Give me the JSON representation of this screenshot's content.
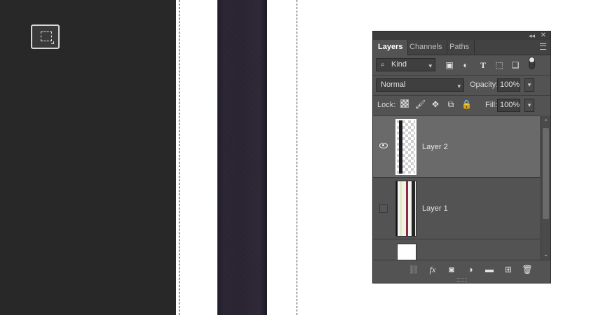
{
  "panel": {
    "collapse_glyph": "◂◂",
    "close_glyph": "✕",
    "tabs": [
      {
        "label": "Layers",
        "active": true
      },
      {
        "label": "Channels",
        "active": false
      },
      {
        "label": "Paths",
        "active": false
      }
    ],
    "filter": {
      "label": "Kind"
    },
    "blend_mode": "Normal",
    "opacity_label": "Opacity:",
    "opacity_value": "100%",
    "lock_label": "Lock:",
    "fill_label": "Fill:",
    "fill_value": "100%",
    "layers": [
      {
        "name": "Layer 2",
        "visible": true,
        "selected": true
      },
      {
        "name": "Layer 1",
        "visible": false,
        "selected": false
      },
      {
        "name": "",
        "visible": false,
        "selected": false
      }
    ]
  },
  "icons": {
    "filter": [
      "image-icon",
      "adjustment-icon",
      "type-icon",
      "shape-icon",
      "smart-object-icon"
    ],
    "lock": [
      "lock-transparent-icon",
      "lock-image-icon",
      "lock-position-icon",
      "lock-artboard-icon",
      "lock-all-icon"
    ],
    "bottom": [
      "link-icon",
      "fx-icon",
      "mask-icon",
      "adjustment-layer-icon",
      "folder-icon",
      "new-layer-icon",
      "trash-icon"
    ]
  },
  "colors": {
    "toolbar_bg": "#282828",
    "panel_bg": "#535353",
    "selected_layer": "#6a6a6a",
    "canvas_bg": "#ffffff",
    "strap": "#2a2432"
  }
}
